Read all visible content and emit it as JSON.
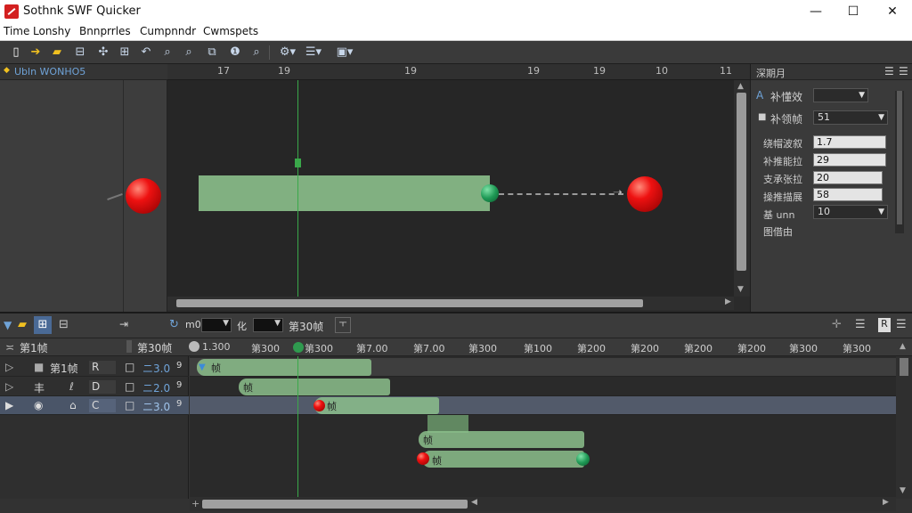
{
  "window": {
    "title": "Sothnk SWF Quicker",
    "minimize": "—",
    "maximize": "☐",
    "close": "✕"
  },
  "menu": [
    "Time",
    "Lonshy",
    "Bnnprrles",
    "Cumpnndr",
    "Cwmspets"
  ],
  "left_panel": {
    "label": "Ubln WONHO5"
  },
  "ruler": [
    "17",
    "19",
    "19",
    "19",
    "19",
    "10",
    "11"
  ],
  "properties": {
    "header": "深期月",
    "tween_label": "补懂效",
    "frame_label": "补领帧",
    "frame_value": "51",
    "rows": [
      {
        "label": "绕帽波叙",
        "value": "1.7"
      },
      {
        "label": "补推能拉",
        "value": "29"
      },
      {
        "label": "支承张拉",
        "value": "20"
      },
      {
        "label": "操推描展",
        "value": "58"
      }
    ],
    "drop_row": {
      "label": "基 unn",
      "value": "10"
    },
    "last_label": "图借由"
  },
  "timeline": {
    "toolbar": {
      "field1_label": "m0",
      "field2_label": "化",
      "frame_label": "第30帧"
    },
    "header_label": "第1帧",
    "header_frame": "第30帧",
    "ticks": [
      "1.300",
      "第300",
      "第300",
      "第7.00",
      "第7.00",
      "第300",
      "第100",
      "第200",
      "第200",
      "第200",
      "第200",
      "第300",
      "第300"
    ],
    "layers": [
      {
        "name": "第1帧",
        "col1": "R",
        "col2": "□",
        "value": "ニ3.0",
        "n": "9"
      },
      {
        "name": "丰",
        "col1": "D",
        "col2": "□",
        "value": "ニ2.0",
        "n": "9"
      },
      {
        "name": "",
        "col1": "C",
        "col2": "□",
        "value": "ニ3.0",
        "n": "9"
      }
    ],
    "tween_labels": [
      "帧",
      "帧",
      "帧",
      "帧",
      "帧"
    ]
  },
  "colors": {
    "accent_blue": "#6fa3d8",
    "tween_green": "#8cc08c",
    "playhead": "#3aa84a",
    "ball_red": "#e11111",
    "ball_green": "#1f9a56"
  }
}
